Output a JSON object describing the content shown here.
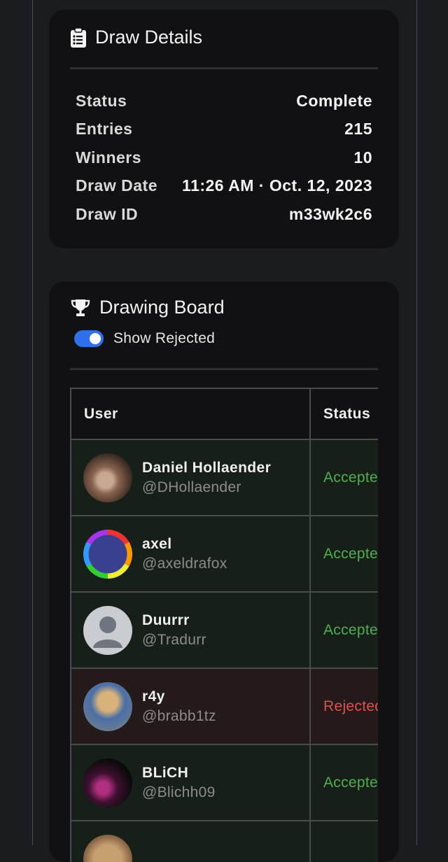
{
  "details": {
    "title": "Draw Details",
    "icon": "clipboard-list-icon",
    "rows": [
      {
        "label": "Status",
        "value": "Complete"
      },
      {
        "label": "Entries",
        "value": "215"
      },
      {
        "label": "Winners",
        "value": "10"
      },
      {
        "label": "Draw Date",
        "value": "11:26 AM · Oct. 12, 2023"
      },
      {
        "label": "Draw ID",
        "value": "m33wk2c6"
      }
    ]
  },
  "board": {
    "title": "Drawing Board",
    "icon": "trophy-icon",
    "toggle_label": "Show Rejected",
    "toggle_on": true,
    "columns": [
      "User",
      "Status"
    ],
    "rows": [
      {
        "name": "Daniel Hollaender",
        "handle": "@DHollaender",
        "status": "Accepted",
        "kind": "accepted"
      },
      {
        "name": "axel",
        "handle": "@axeldrafox",
        "status": "Accepted",
        "kind": "accepted"
      },
      {
        "name": "Duurrr",
        "handle": "@Tradurr",
        "status": "Accepted",
        "kind": "accepted"
      },
      {
        "name": "r4y",
        "handle": "@brabb1tz",
        "status": "Rejected",
        "kind": "rejected"
      },
      {
        "name": "BLiCH",
        "handle": "@Blichh09",
        "status": "Accepted",
        "kind": "accepted"
      },
      {
        "name": "",
        "handle": "",
        "status": "",
        "kind": "accepted"
      }
    ]
  },
  "colors": {
    "accepted": "#4fae4f",
    "rejected": "#e05050",
    "toggle": "#2f6fe9"
  }
}
